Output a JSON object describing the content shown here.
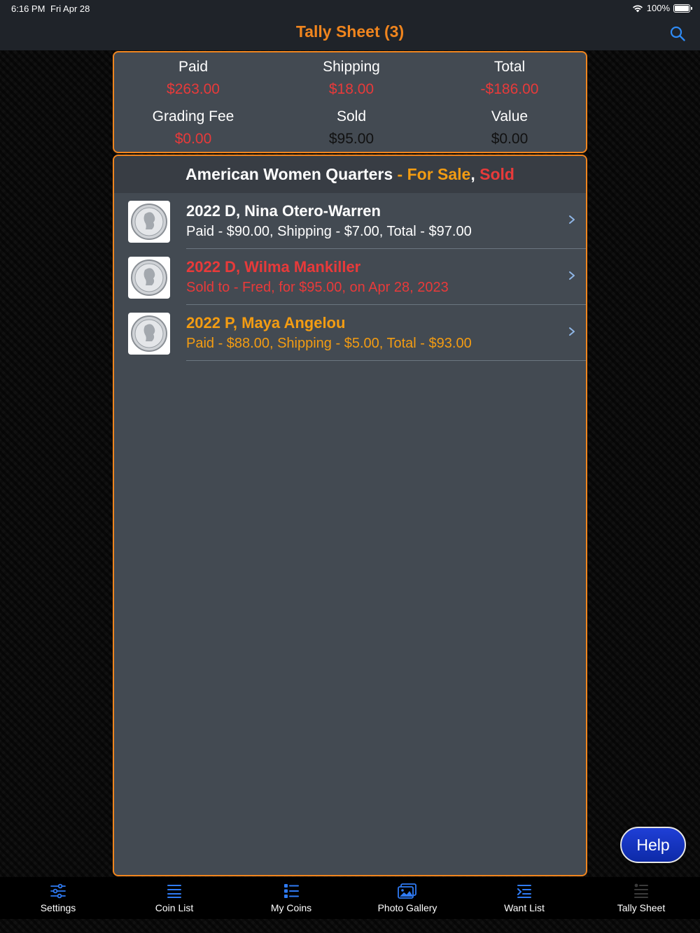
{
  "status_bar": {
    "time": "6:16 PM",
    "date": "Fri Apr 28",
    "battery": "100%"
  },
  "nav": {
    "title": "Tally Sheet (3)",
    "search_icon": "search-icon"
  },
  "summary": {
    "paid_label": "Paid",
    "paid_value": "$263.00",
    "shipping_label": "Shipping",
    "shipping_value": "$18.00",
    "total_label": "Total",
    "total_value": "-$186.00",
    "grading_label": "Grading Fee",
    "grading_value": "$0.00",
    "sold_label": "Sold",
    "sold_value": "$95.00",
    "value_label": "Value",
    "value_value": "$0.00"
  },
  "section": {
    "series": "American Women Quarters",
    "dash": " - ",
    "for_sale": "For Sale",
    "comma": ", ",
    "sold": "Sold"
  },
  "coins": [
    {
      "title": "2022 D, Nina Otero-Warren",
      "subtitle": "Paid - $90.00, Shipping - $7.00, Total - $97.00",
      "status_color": "#ffffff"
    },
    {
      "title": "2022 D, Wilma Mankiller",
      "subtitle": "Sold to - Fred, for $95.00, on Apr 28, 2023",
      "status_color": "#e83a3a"
    },
    {
      "title": "2022 P, Maya Angelou",
      "subtitle": "Paid - $88.00, Shipping - $5.00, Total - $93.00",
      "status_color": "#f39c12"
    }
  ],
  "help": {
    "label": "Help"
  },
  "tabs": [
    {
      "label": "Settings",
      "icon": "sliders-icon"
    },
    {
      "label": "Coin List",
      "icon": "list-icon"
    },
    {
      "label": "My Coins",
      "icon": "bulleted-list-icon"
    },
    {
      "label": "Photo Gallery",
      "icon": "photo-gallery-icon"
    },
    {
      "label": "Want List",
      "icon": "want-list-icon"
    },
    {
      "label": "Tally Sheet",
      "icon": "tally-sheet-icon"
    }
  ],
  "colors": {
    "accent_orange": "#f0851e",
    "tab_icon_blue": "#2f7bf5",
    "negative_red": "#e83a3a"
  }
}
